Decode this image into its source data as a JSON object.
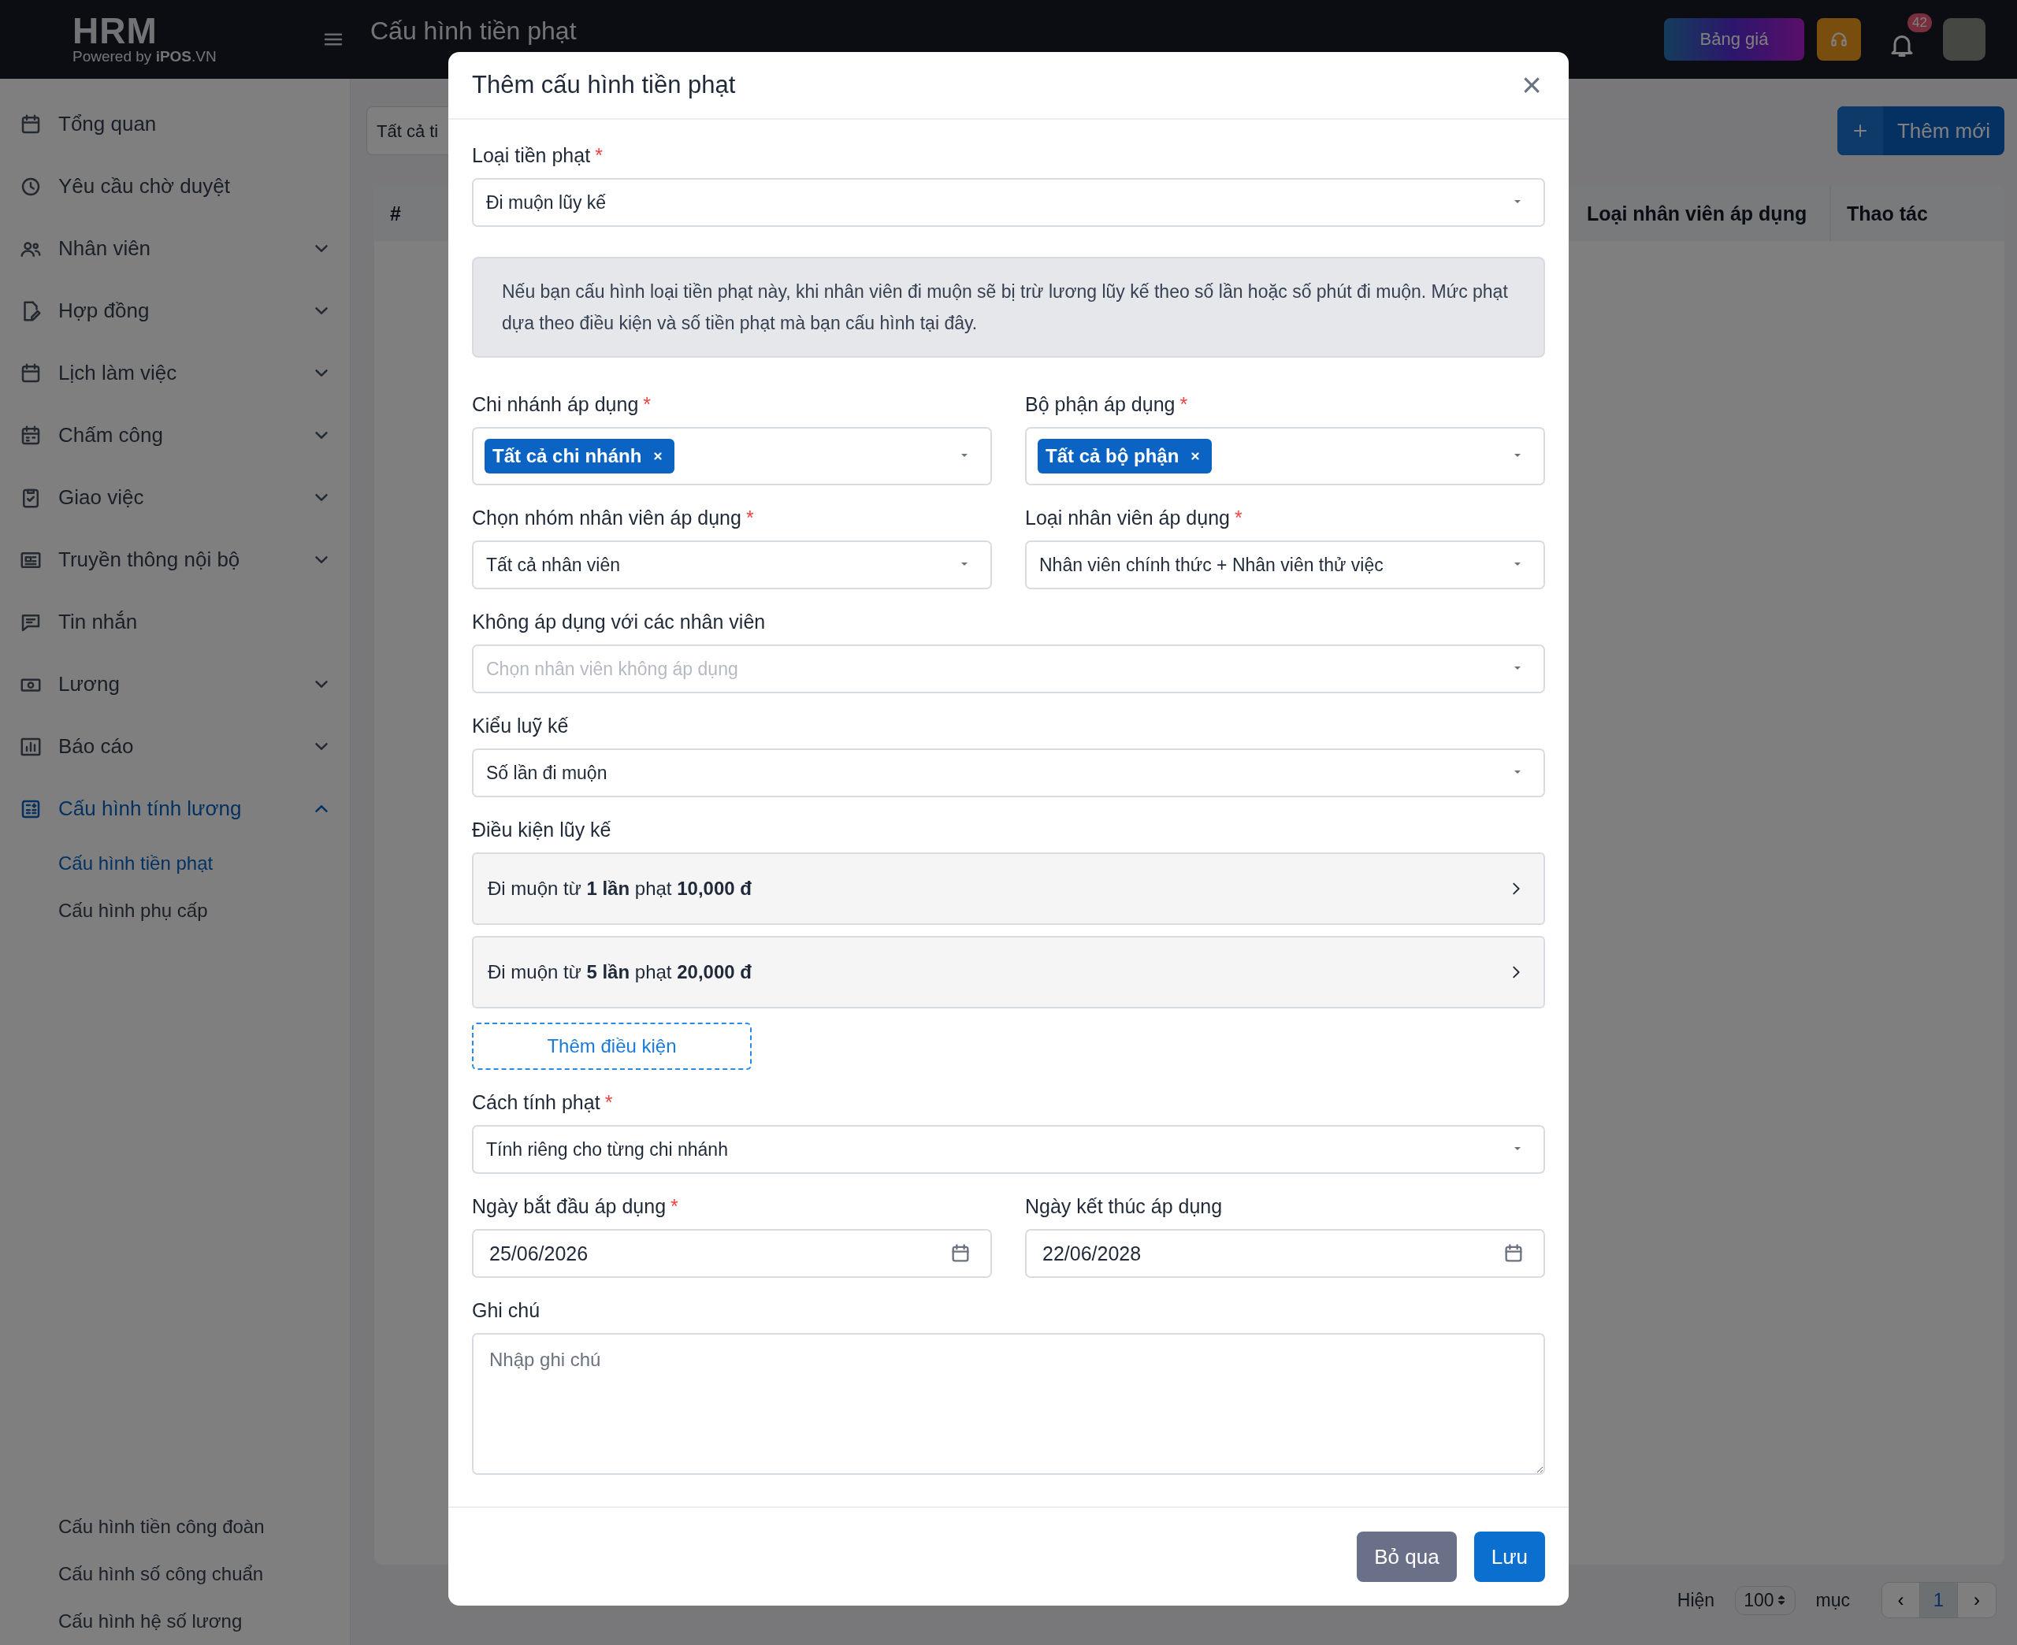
{
  "topbar": {
    "logo_title": "HRM",
    "logo_subtitle": "Powered by **iPOS**.VN",
    "page_title": "Cấu hình tiền phạt",
    "pricing_button": "Bảng giá",
    "notification_count": "42"
  },
  "sidebar": {
    "items": [
      {
        "label": "Tổng quan",
        "selected": false
      },
      {
        "label": "Yêu cầu chờ duyệt",
        "selected": false
      },
      {
        "label": "Nhân viên",
        "expanded": false,
        "selected": false
      },
      {
        "label": "Hợp đồng",
        "expanded": false,
        "selected": false
      },
      {
        "label": "Lịch làm việc",
        "expanded": false,
        "selected": false
      },
      {
        "label": "Chấm công",
        "expanded": false,
        "selected": false
      },
      {
        "label": "Giao việc",
        "expanded": false,
        "selected": false
      },
      {
        "label": "Truyền thông nội bộ",
        "expanded": false,
        "selected": false
      },
      {
        "label": "Tin nhắn",
        "selected": false
      },
      {
        "label": "Lương",
        "expanded": false,
        "selected": false
      },
      {
        "label": "Báo cáo",
        "expanded": false,
        "selected": false
      },
      {
        "label": "Cấu hình tính lương",
        "expanded": true,
        "selected": true,
        "children": [
          {
            "label": "Cấu hình tiền phạt",
            "selected": true
          },
          {
            "label": "Cấu hình phụ cấp",
            "selected": false
          }
        ]
      }
    ],
    "bottom_items": [
      {
        "label": "Cấu hình tiền công đoàn",
        "selected": false
      },
      {
        "label": "Cấu hình số công chuẩn",
        "selected": false
      },
      {
        "label": "Cấu hình hệ số lương",
        "selected": false
      }
    ]
  },
  "main": {
    "filter_value": "Tất cả ti",
    "add_button": "Thêm mới",
    "table": {
      "columns": [
        "#",
        "Loại nhân viên áp dụng",
        "Thao tác"
      ]
    },
    "pagination": {
      "show_label": "Hiện",
      "page_size": "100",
      "unit_label": "mục",
      "prev": "‹",
      "pages": [
        {
          "label": "1",
          "selected": true
        }
      ],
      "next": "›"
    }
  },
  "modal": {
    "title": "Thêm cấu hình tiền phạt",
    "close": "×",
    "rows": [
      [
        {
          "kind": "select",
          "label": "Loại tiền phạt",
          "required_mark": "*",
          "value": "Đi muộn lũy kế"
        }
      ],
      [
        {
          "kind": "info",
          "text": "Nếu bạn cấu hình loại tiền phạt này, khi nhân viên đi muộn sẽ bị trừ lương lũy kế theo số lần hoặc số phút đi muộn. Mức phạt dựa theo điều kiện và số tiền phạt mà bạn cấu hình tại đây."
        }
      ],
      [
        {
          "kind": "tags",
          "label": "Chi nhánh áp dụng",
          "required_mark": "*",
          "tags": [
            "Tất cả chi nhánh"
          ]
        },
        {
          "kind": "tags",
          "label": "Bộ phận áp dụng",
          "required_mark": "*",
          "tags": [
            "Tất cả bộ phận"
          ]
        }
      ],
      [
        {
          "kind": "select",
          "label": "Chọn nhóm nhân viên áp dụng",
          "required_mark": "*",
          "value": "Tất cả nhân viên"
        },
        {
          "kind": "select",
          "label": "Loại nhân viên áp dụng",
          "required_mark": "*",
          "value": "Nhân viên chính thức + Nhân viên thử việc"
        }
      ],
      [
        {
          "kind": "select",
          "label": "Không áp dụng với các nhân viên",
          "placeholder": "Chọn nhân viên không áp dụng"
        }
      ],
      [
        {
          "kind": "select",
          "label": "Kiểu luỹ kế",
          "value": "Số lần đi muộn"
        }
      ],
      [
        {
          "kind": "conditions",
          "label": "Điều kiện lũy kế",
          "items": [
            "Đi muộn từ **1 lần** phạt **10,000 đ**",
            "Đi muộn từ **5 lần** phạt **20,000 đ**"
          ],
          "add_label": "Thêm điều kiện"
        }
      ],
      [
        {
          "kind": "select",
          "label": "Cách tính phạt",
          "required_mark": "*",
          "value": "Tính riêng cho từng chi nhánh"
        }
      ],
      [
        {
          "kind": "date",
          "label": "Ngày bắt đầu áp dụng",
          "required_mark": "*",
          "value": "25/06/2026"
        },
        {
          "kind": "date",
          "label": "Ngày kết thúc áp dụng",
          "value": "22/06/2028"
        }
      ],
      [
        {
          "kind": "textarea",
          "label": "Ghi chú",
          "placeholder": "Nhập ghi chú"
        }
      ]
    ],
    "buttons": [
      {
        "label": "Bỏ qua",
        "kind": "secondary"
      },
      {
        "label": "Lưu",
        "kind": "primary"
      }
    ]
  }
}
